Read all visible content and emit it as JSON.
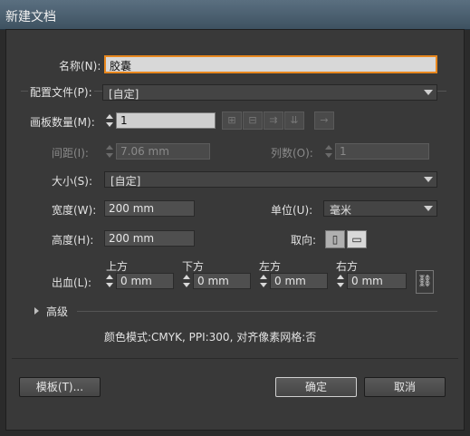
{
  "window": {
    "title": "新建文档"
  },
  "form": {
    "name_label": "名称(N):",
    "name_value": "胶囊",
    "profile_label": "配置文件(P):",
    "profile_value": "[自定]",
    "artboards_label": "画板数量(M):",
    "artboards_value": "1",
    "spacing_label": "间距(I):",
    "spacing_value": "7.06 mm",
    "columns_label": "列数(O):",
    "columns_value": "1",
    "size_label": "大小(S):",
    "size_value": "[自定]",
    "width_label": "宽度(W):",
    "width_value": "200 mm",
    "units_label": "单位(U):",
    "units_value": "毫米",
    "height_label": "高度(H):",
    "height_value": "200 mm",
    "orientation_label": "取向:",
    "bleed_label": "出血(L):",
    "bleed": {
      "top_label": "上方",
      "top_value": "0 mm",
      "bottom_label": "下方",
      "bottom_value": "0 mm",
      "left_label": "左方",
      "left_value": "0 mm",
      "right_label": "右方",
      "right_value": "0 mm"
    },
    "advanced_label": "高级",
    "info_text": "颜色模式:CMYK, PPI:300, 对齐像素网格:否"
  },
  "buttons": {
    "templates": "模板(T)...",
    "ok": "确定",
    "cancel": "取消"
  },
  "colors": {
    "focus_accent": "#e8871e",
    "dialog_bg": "#393939"
  },
  "icons": [
    "grid-by-row-icon",
    "grid-by-column-icon",
    "arrange-by-row-icon",
    "arrange-by-column-icon",
    "right-to-left-icon",
    "portrait-icon",
    "landscape-icon",
    "link-icon",
    "expand-triangle-icon"
  ]
}
